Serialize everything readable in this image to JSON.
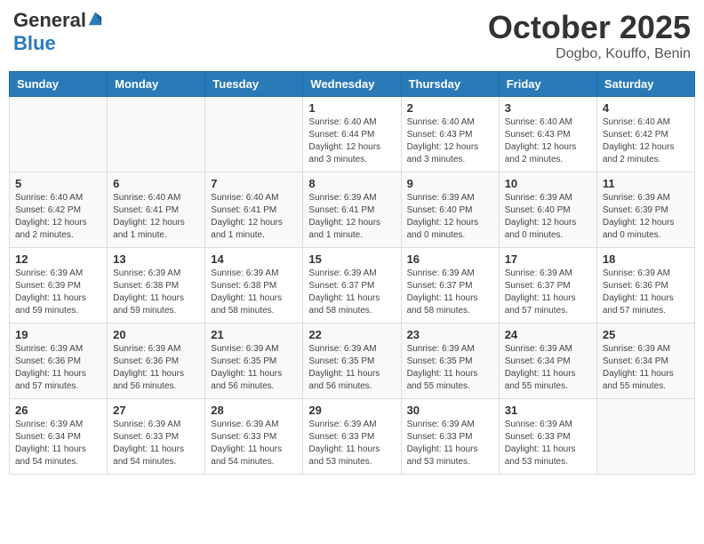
{
  "logo": {
    "general": "General",
    "blue": "Blue"
  },
  "title": "October 2025",
  "subtitle": "Dogbo, Kouffo, Benin",
  "headers": [
    "Sunday",
    "Monday",
    "Tuesday",
    "Wednesday",
    "Thursday",
    "Friday",
    "Saturday"
  ],
  "weeks": [
    [
      {
        "day": "",
        "info": ""
      },
      {
        "day": "",
        "info": ""
      },
      {
        "day": "",
        "info": ""
      },
      {
        "day": "1",
        "info": "Sunrise: 6:40 AM\nSunset: 6:44 PM\nDaylight: 12 hours\nand 3 minutes."
      },
      {
        "day": "2",
        "info": "Sunrise: 6:40 AM\nSunset: 6:43 PM\nDaylight: 12 hours\nand 3 minutes."
      },
      {
        "day": "3",
        "info": "Sunrise: 6:40 AM\nSunset: 6:43 PM\nDaylight: 12 hours\nand 2 minutes."
      },
      {
        "day": "4",
        "info": "Sunrise: 6:40 AM\nSunset: 6:42 PM\nDaylight: 12 hours\nand 2 minutes."
      }
    ],
    [
      {
        "day": "5",
        "info": "Sunrise: 6:40 AM\nSunset: 6:42 PM\nDaylight: 12 hours\nand 2 minutes."
      },
      {
        "day": "6",
        "info": "Sunrise: 6:40 AM\nSunset: 6:41 PM\nDaylight: 12 hours\nand 1 minute."
      },
      {
        "day": "7",
        "info": "Sunrise: 6:40 AM\nSunset: 6:41 PM\nDaylight: 12 hours\nand 1 minute."
      },
      {
        "day": "8",
        "info": "Sunrise: 6:39 AM\nSunset: 6:41 PM\nDaylight: 12 hours\nand 1 minute."
      },
      {
        "day": "9",
        "info": "Sunrise: 6:39 AM\nSunset: 6:40 PM\nDaylight: 12 hours\nand 0 minutes."
      },
      {
        "day": "10",
        "info": "Sunrise: 6:39 AM\nSunset: 6:40 PM\nDaylight: 12 hours\nand 0 minutes."
      },
      {
        "day": "11",
        "info": "Sunrise: 6:39 AM\nSunset: 6:39 PM\nDaylight: 12 hours\nand 0 minutes."
      }
    ],
    [
      {
        "day": "12",
        "info": "Sunrise: 6:39 AM\nSunset: 6:39 PM\nDaylight: 11 hours\nand 59 minutes."
      },
      {
        "day": "13",
        "info": "Sunrise: 6:39 AM\nSunset: 6:38 PM\nDaylight: 11 hours\nand 59 minutes."
      },
      {
        "day": "14",
        "info": "Sunrise: 6:39 AM\nSunset: 6:38 PM\nDaylight: 11 hours\nand 58 minutes."
      },
      {
        "day": "15",
        "info": "Sunrise: 6:39 AM\nSunset: 6:37 PM\nDaylight: 11 hours\nand 58 minutes."
      },
      {
        "day": "16",
        "info": "Sunrise: 6:39 AM\nSunset: 6:37 PM\nDaylight: 11 hours\nand 58 minutes."
      },
      {
        "day": "17",
        "info": "Sunrise: 6:39 AM\nSunset: 6:37 PM\nDaylight: 11 hours\nand 57 minutes."
      },
      {
        "day": "18",
        "info": "Sunrise: 6:39 AM\nSunset: 6:36 PM\nDaylight: 11 hours\nand 57 minutes."
      }
    ],
    [
      {
        "day": "19",
        "info": "Sunrise: 6:39 AM\nSunset: 6:36 PM\nDaylight: 11 hours\nand 57 minutes."
      },
      {
        "day": "20",
        "info": "Sunrise: 6:39 AM\nSunset: 6:36 PM\nDaylight: 11 hours\nand 56 minutes."
      },
      {
        "day": "21",
        "info": "Sunrise: 6:39 AM\nSunset: 6:35 PM\nDaylight: 11 hours\nand 56 minutes."
      },
      {
        "day": "22",
        "info": "Sunrise: 6:39 AM\nSunset: 6:35 PM\nDaylight: 11 hours\nand 56 minutes."
      },
      {
        "day": "23",
        "info": "Sunrise: 6:39 AM\nSunset: 6:35 PM\nDaylight: 11 hours\nand 55 minutes."
      },
      {
        "day": "24",
        "info": "Sunrise: 6:39 AM\nSunset: 6:34 PM\nDaylight: 11 hours\nand 55 minutes."
      },
      {
        "day": "25",
        "info": "Sunrise: 6:39 AM\nSunset: 6:34 PM\nDaylight: 11 hours\nand 55 minutes."
      }
    ],
    [
      {
        "day": "26",
        "info": "Sunrise: 6:39 AM\nSunset: 6:34 PM\nDaylight: 11 hours\nand 54 minutes."
      },
      {
        "day": "27",
        "info": "Sunrise: 6:39 AM\nSunset: 6:33 PM\nDaylight: 11 hours\nand 54 minutes."
      },
      {
        "day": "28",
        "info": "Sunrise: 6:39 AM\nSunset: 6:33 PM\nDaylight: 11 hours\nand 54 minutes."
      },
      {
        "day": "29",
        "info": "Sunrise: 6:39 AM\nSunset: 6:33 PM\nDaylight: 11 hours\nand 53 minutes."
      },
      {
        "day": "30",
        "info": "Sunrise: 6:39 AM\nSunset: 6:33 PM\nDaylight: 11 hours\nand 53 minutes."
      },
      {
        "day": "31",
        "info": "Sunrise: 6:39 AM\nSunset: 6:33 PM\nDaylight: 11 hours\nand 53 minutes."
      },
      {
        "day": "",
        "info": ""
      }
    ]
  ]
}
